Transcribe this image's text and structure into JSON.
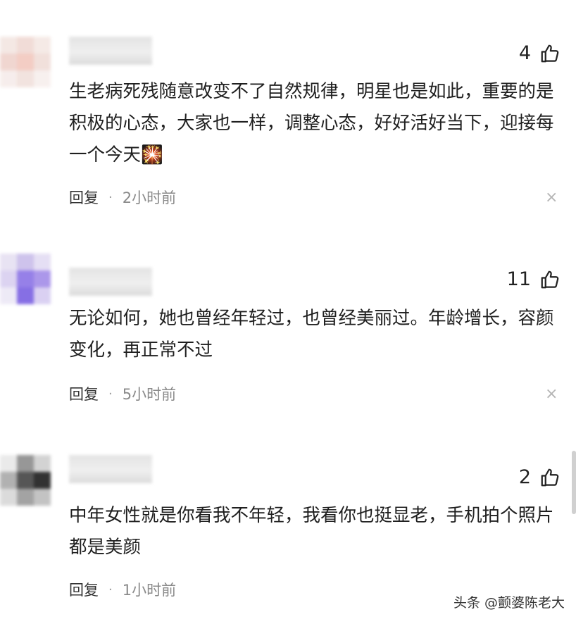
{
  "comments": [
    {
      "likes": "4",
      "text": "生老病死残随意改变不了自然规律，明星也是如此，重要的是积极的心态，大家也一样，调整心态，好好活好当下，迎接每一个今天",
      "emoji": "🎇",
      "reply_label": "回复",
      "dot": "·",
      "time": "2小时前"
    },
    {
      "likes": "11",
      "text": "无论如何，她也曾经年轻过，也曾经美丽过。年龄增长，容颜变化，再正常不过",
      "reply_label": "回复",
      "dot": "·",
      "time": "5小时前"
    },
    {
      "likes": "2",
      "text": "中年女性就是你看我不年轻，我看你也挺显老，手机拍个照片都是美颜",
      "reply_label": "回复",
      "dot": "·",
      "time": "1小时前"
    }
  ],
  "icons": {
    "like": "thumbs-up-icon",
    "close": "close-icon"
  },
  "watermark": "头条 @颤婆陈老大"
}
